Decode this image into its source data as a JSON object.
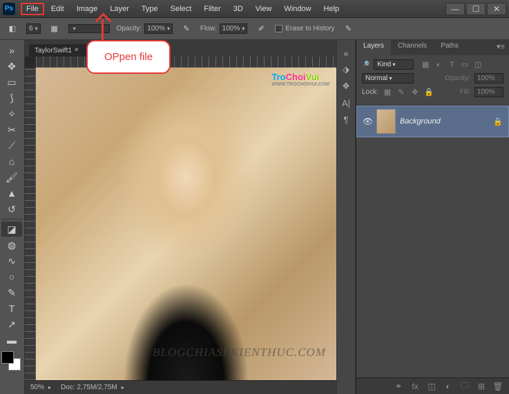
{
  "app": {
    "logo_text": "Ps"
  },
  "menu": {
    "items": [
      "File",
      "Edit",
      "Image",
      "Layer",
      "Type",
      "Select",
      "Filter",
      "3D",
      "View",
      "Window",
      "Help"
    ],
    "highlighted_index": 0
  },
  "window_controls": {
    "min": "—",
    "max": "☐",
    "close": "✕"
  },
  "options_bar": {
    "size_label": "6",
    "opacity_label": "Opacity:",
    "opacity_value": "100%",
    "flow_label": "Flow:",
    "flow_value": "100%",
    "erase_history_label": "Erase to History"
  },
  "document": {
    "tab_title": "TaylorSwift1",
    "zoom": "50%",
    "doc_info": "Doc: 2,75M/2,75M"
  },
  "image_watermarks": {
    "tro": "Tro",
    "choi": "Choi",
    "vui": "Vui",
    "url": "WWW.TROCHOIVUI.COM",
    "bottom": "BLOGCHIASEKIENTHUC.COM"
  },
  "dock_strip": {
    "icons": [
      "⬗",
      "❖",
      "A|",
      "¶"
    ]
  },
  "layers_panel": {
    "tabs": [
      "Layers",
      "Channels",
      "Paths"
    ],
    "active_tab": 0,
    "kind_selector": "Kind",
    "blend_mode": "Normal",
    "opacity_label": "Opacity:",
    "opacity_value": "100%",
    "lock_label": "Lock:",
    "fill_label": "Fill:",
    "fill_value": "100%",
    "layers": [
      {
        "name": "Background",
        "visible": true,
        "locked": true
      }
    ]
  },
  "callout": {
    "text": "OPpen file"
  },
  "colors": {
    "highlight": "#e53935",
    "selected_layer": "#5a6e8c"
  }
}
